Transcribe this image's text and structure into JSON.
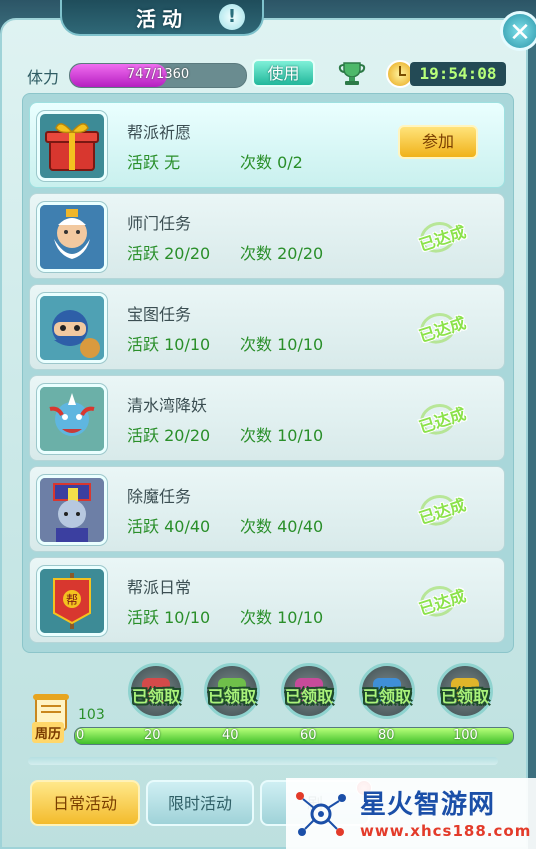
{
  "header": {
    "title": "活动",
    "alert_icon": "exclamation-icon",
    "close_icon": "close-icon"
  },
  "stamina": {
    "label": "体力",
    "current": 747,
    "max": 1360,
    "text": "747/1360",
    "use_label": "使用"
  },
  "clock": {
    "time": "19:54:08"
  },
  "activities": [
    {
      "title": "帮派祈愿",
      "active_label": "活跃",
      "active_value": "无",
      "count_label": "次数",
      "count_value": "0/2",
      "status": "join",
      "status_label": "参加",
      "icon": "gift-box-icon"
    },
    {
      "title": "师门任务",
      "active_label": "活跃",
      "active_value": "20/20",
      "count_label": "次数",
      "count_value": "20/20",
      "status": "done",
      "status_label": "已达成",
      "icon": "elder-master-icon"
    },
    {
      "title": "宝图任务",
      "active_label": "活跃",
      "active_value": "10/10",
      "count_label": "次数",
      "count_value": "10/10",
      "status": "done",
      "status_label": "已达成",
      "icon": "ninja-icon"
    },
    {
      "title": "清水湾降妖",
      "active_label": "活跃",
      "active_value": "20/20",
      "count_label": "次数",
      "count_value": "10/10",
      "status": "done",
      "status_label": "已达成",
      "icon": "blue-demon-icon"
    },
    {
      "title": "除魔任务",
      "active_label": "活跃",
      "active_value": "40/40",
      "count_label": "次数",
      "count_value": "40/40",
      "status": "done",
      "status_label": "已达成",
      "icon": "jiangshi-icon"
    },
    {
      "title": "帮派日常",
      "active_label": "活跃",
      "active_value": "10/10",
      "count_label": "次数",
      "count_value": "10/10",
      "status": "done",
      "status_label": "已达成",
      "icon": "guild-banner-icon"
    }
  ],
  "rewards": {
    "chests": [
      {
        "label": "已领取",
        "icon": "reward-chest-icon",
        "color": "#d44a4a"
      },
      {
        "label": "已领取",
        "icon": "reward-chest-icon",
        "color": "#6fbf4a"
      },
      {
        "label": "已领取",
        "icon": "reward-chest-icon",
        "color": "#c74b9a"
      },
      {
        "label": "已领取",
        "icon": "reward-chest-icon",
        "color": "#3f8fd8"
      },
      {
        "label": "已领取",
        "icon": "reward-chest-icon",
        "color": "#e0b52a"
      }
    ],
    "calendar_label": "周历",
    "weekly_value": "103",
    "progress_fraction": 1.0,
    "ticks": [
      "0",
      "20",
      "40",
      "60",
      "80",
      "100"
    ]
  },
  "tabs": [
    {
      "label": "日常活动",
      "selected": true
    },
    {
      "label": "限时活动",
      "selected": false
    },
    {
      "label": "剧",
      "selected": false
    }
  ],
  "watermark": {
    "name": "星火智游网",
    "url": "www.xhcs188.com"
  },
  "colors": {
    "accent_green": "#2a8f2a",
    "stamina_purple": "#c23ad0",
    "time_green": "#b7ff7a"
  }
}
